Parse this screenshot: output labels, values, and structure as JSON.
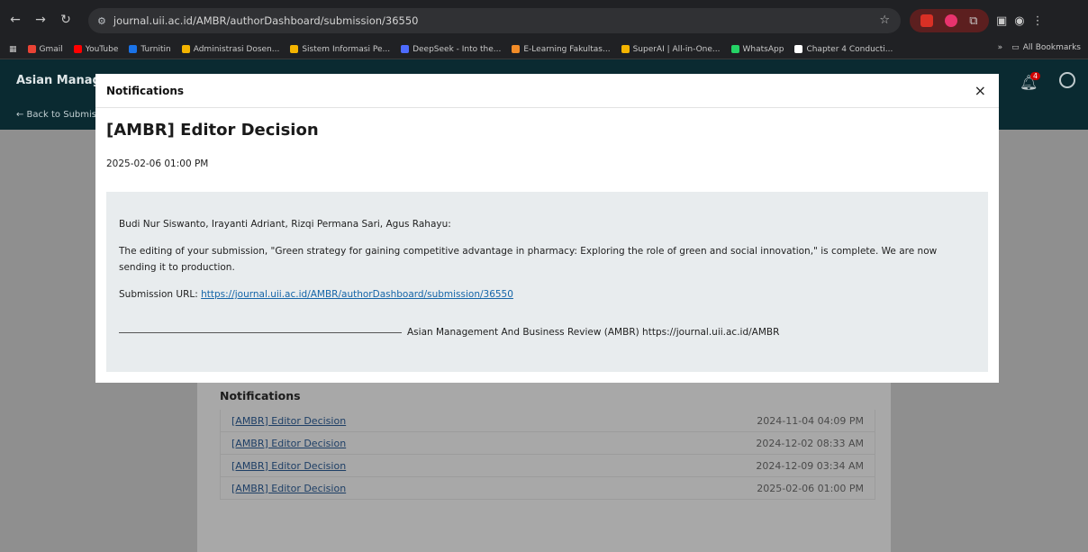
{
  "browser": {
    "url": "journal.uii.ac.id/AMBR/authorDashboard/submission/36550",
    "bookmarks": [
      {
        "label": "Gmail",
        "color": "#ea4335"
      },
      {
        "label": "YouTube",
        "color": "#ff0000"
      },
      {
        "label": "Turnitin",
        "color": "#1a73e8"
      },
      {
        "label": "Administrasi Dosen...",
        "color": "#f4b400"
      },
      {
        "label": "Sistem Informasi Pe...",
        "color": "#f4b400"
      },
      {
        "label": "DeepSeek - Into the...",
        "color": "#4d6bfe"
      },
      {
        "label": "E-Learning Fakultas...",
        "color": "#f28c28"
      },
      {
        "label": "SuperAI | All-in-One...",
        "color": "#f4b400"
      },
      {
        "label": "WhatsApp",
        "color": "#25d366"
      },
      {
        "label": "Chapter 4 Conducti...",
        "color": "#ffffff"
      }
    ],
    "all_bookmarks": "All Bookmarks",
    "more": "»"
  },
  "site": {
    "title": "Asian Manage",
    "back_link": "← Back to Submis",
    "notification_count": "4"
  },
  "modal": {
    "header": "Notifications",
    "close": "×",
    "title": "[AMBR] Editor Decision",
    "date": "2025-02-06 01:00 PM",
    "greeting": "Budi Nur Siswanto, Irayanti Adriant, Rizqi Permana Sari, Agus Rahayu:",
    "body": "The editing of your submission, \"Green strategy for gaining competitive advantage in pharmacy: Exploring the role of green and social innovation,\" is complete. We are now sending it to production.",
    "url_label": "Submission URL: ",
    "url": "https://journal.uii.ac.id/AMBR/authorDashboard/submission/36550",
    "signature": "Asian Management And Business Review (AMBR) https://journal.uii.ac.id/AMBR"
  },
  "notifications": {
    "heading": "Notifications",
    "items": [
      {
        "label": "[AMBR] Editor Decision",
        "date": "2024-11-04 04:09 PM"
      },
      {
        "label": "[AMBR] Editor Decision",
        "date": "2024-12-02 08:33 AM"
      },
      {
        "label": "[AMBR] Editor Decision",
        "date": "2024-12-09 03:34 AM"
      },
      {
        "label": "[AMBR] Editor Decision",
        "date": "2025-02-06 01:00 PM"
      }
    ]
  }
}
